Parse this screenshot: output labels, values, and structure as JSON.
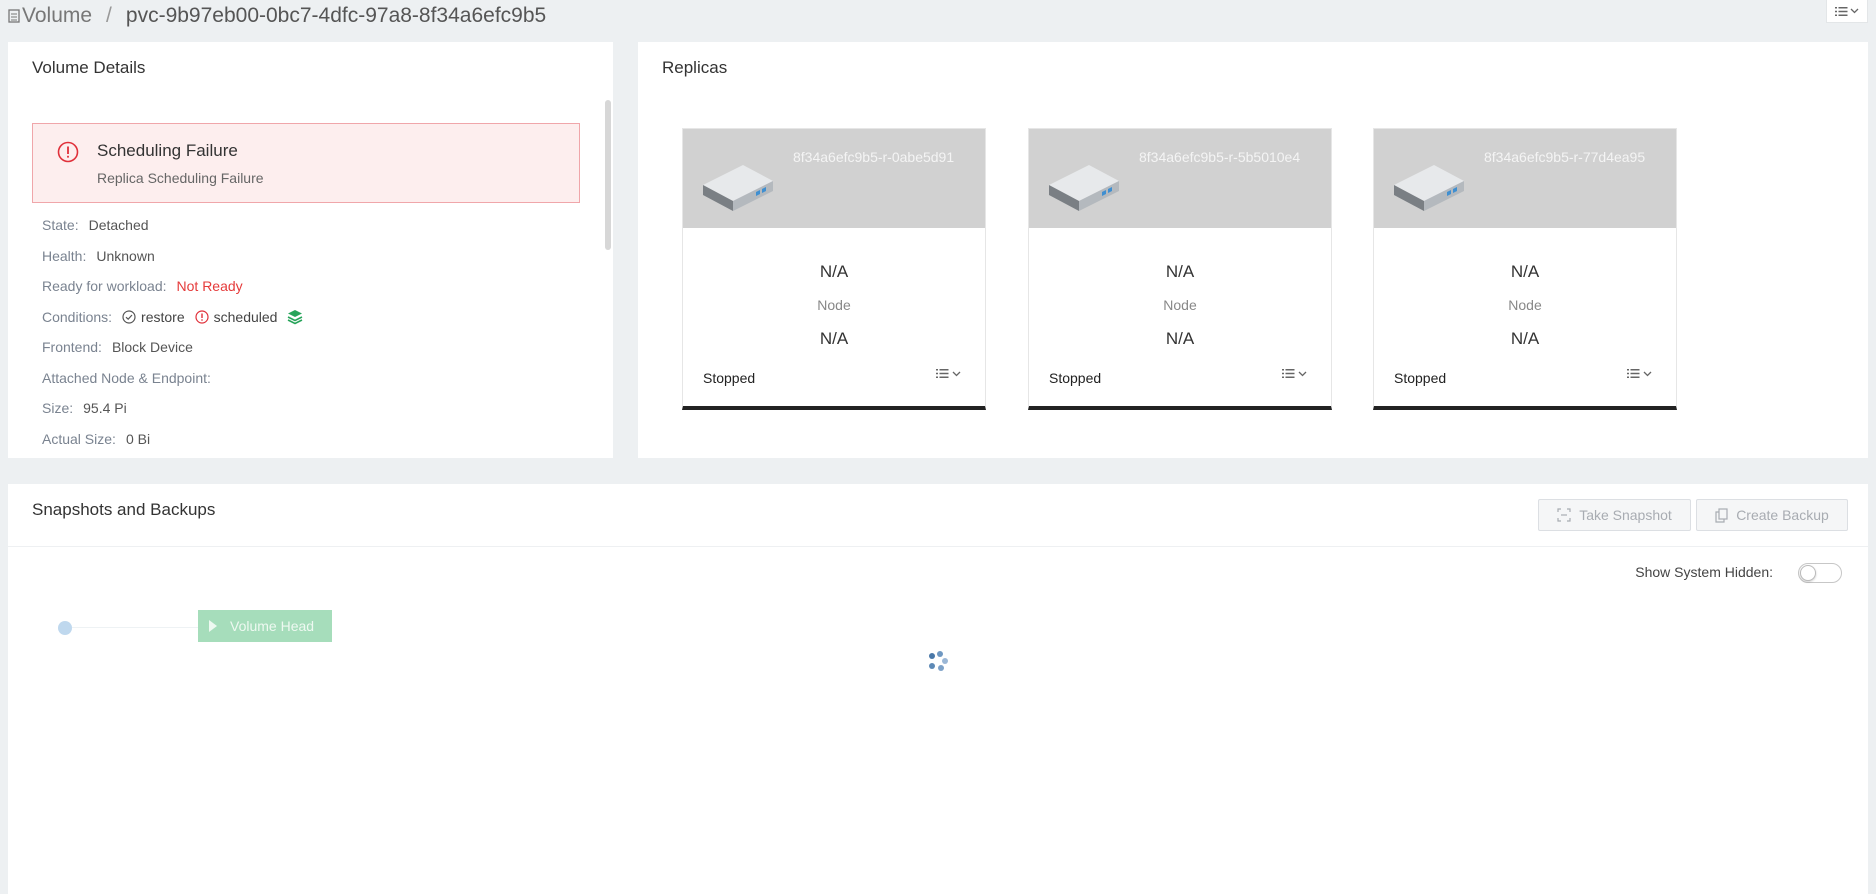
{
  "breadcrumb": {
    "root": "Volume",
    "separator": "/",
    "current": "pvc-9b97eb00-0bc7-4dfc-97a8-8f34a6efc9b5"
  },
  "details": {
    "title": "Volume Details",
    "alert": {
      "title": "Scheduling Failure",
      "message": "Replica Scheduling Failure"
    },
    "rows": {
      "state_label": "State:",
      "state_value": "Detached",
      "health_label": "Health:",
      "health_value": "Unknown",
      "ready_label": "Ready for workload:",
      "ready_value": "Not Ready",
      "conditions_label": "Conditions:",
      "condition_restore": "restore",
      "condition_scheduled": "scheduled",
      "frontend_label": "Frontend:",
      "frontend_value": "Block Device",
      "attached_label": "Attached Node & Endpoint:",
      "size_label": "Size:",
      "size_value": "95.4 Pi",
      "actual_size_label": "Actual Size:",
      "actual_size_value": "0 Bi"
    }
  },
  "replicas": {
    "title": "Replicas",
    "items": [
      {
        "name": "8f34a6efc9b5-r-0abe5d91",
        "value1": "N/A",
        "node_label": "Node",
        "value2": "N/A",
        "status": "Stopped"
      },
      {
        "name": "8f34a6efc9b5-r-5b5010e4",
        "value1": "N/A",
        "node_label": "Node",
        "value2": "N/A",
        "status": "Stopped"
      },
      {
        "name": "8f34a6efc9b5-r-77d4ea95",
        "value1": "N/A",
        "node_label": "Node",
        "value2": "N/A",
        "status": "Stopped"
      }
    ]
  },
  "snapshots": {
    "title": "Snapshots and Backups",
    "take_snapshot_label": "Take Snapshot",
    "create_backup_label": "Create Backup",
    "show_system_hidden_label": "Show System Hidden:",
    "show_system_hidden_on": false,
    "volume_head_label": "Volume Head"
  },
  "colors": {
    "alert_bg": "#fdeeee",
    "alert_border": "#f0a6aa",
    "danger": "#e53b3b",
    "success": "#27a45a",
    "card_header": "#d1d1d1",
    "volume_head": "#a6ddbb"
  },
  "icons": {
    "breadcrumb": "document-icon",
    "alert": "exclamation-circle-icon",
    "restore": "check-circle-icon",
    "scheduled": "exclamation-circle-icon",
    "layers": "layers-icon",
    "replica": "disk-drive-icon",
    "menu": "list-menu-icon",
    "snapshot": "camera-frame-icon",
    "backup": "copy-icon"
  }
}
